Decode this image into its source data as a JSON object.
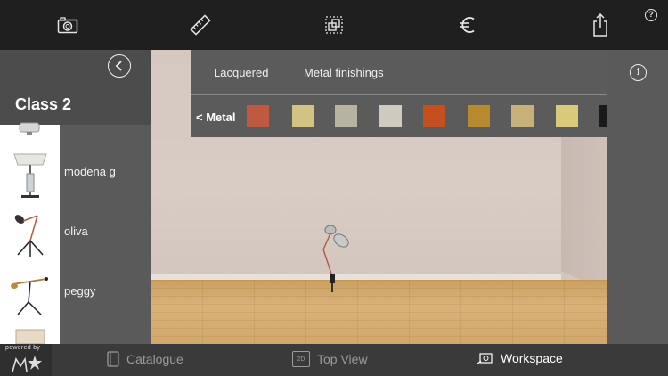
{
  "toolbar": {
    "icons": [
      "camera-icon",
      "ruler-icon",
      "duplicate-icon",
      "euro-icon",
      "share-icon"
    ],
    "help_label": "?"
  },
  "sidebar": {
    "title": "Class 2",
    "items": [
      {
        "label": "modena g"
      },
      {
        "label": "oliva"
      },
      {
        "label": "peggy"
      }
    ]
  },
  "materials": {
    "tabs": [
      "Lacquered",
      "Metal finishings"
    ],
    "back_label": "< Metal",
    "info_label": "i",
    "swatches": [
      "#bf5a40",
      "#d2c383",
      "#b7b3a0",
      "#cfcac0",
      "#c4501f",
      "#b88a2e",
      "#c8b07a",
      "#d9c97b",
      "#1a1a1a"
    ]
  },
  "bottom_bar": {
    "powered_by": "powered by",
    "tabs": [
      {
        "label": "Catalogue",
        "active": false
      },
      {
        "label": "Top View",
        "icon_text": "2D",
        "active": false
      },
      {
        "label": "Workspace",
        "active": true
      }
    ]
  },
  "colors": {
    "toolbar_bg": "#1f1f1f",
    "panel_bg": "#5b5b5b",
    "tab_inactive": "#9a9a9a",
    "tab_active": "#ffffff"
  }
}
